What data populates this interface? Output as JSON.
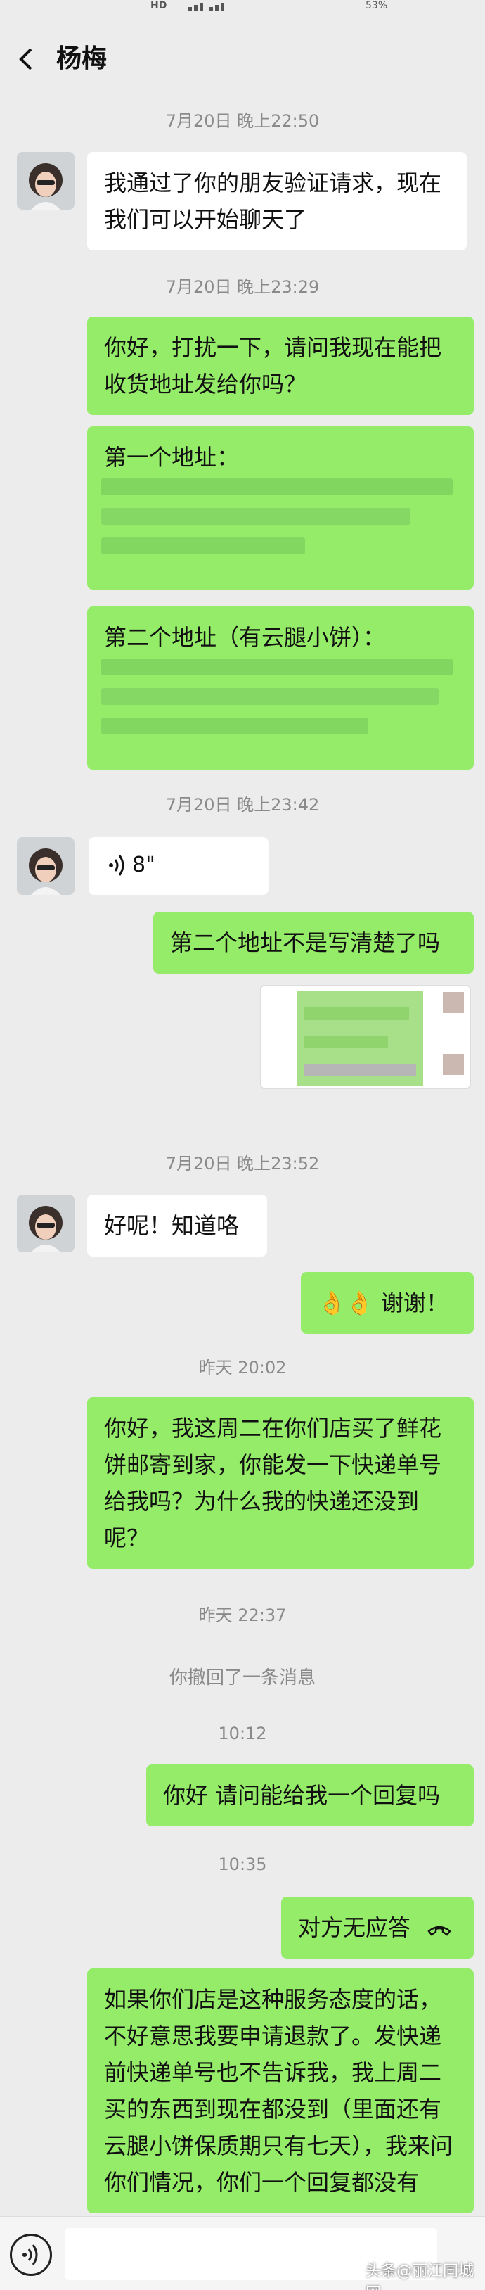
{
  "status": {
    "network": "HD",
    "battery": "53%"
  },
  "header": {
    "title": "杨梅"
  },
  "messages": {
    "ts1": "7月20日 晚上22:50",
    "m1": "我通过了你的朋友验证请求，现在我们可以开始聊天了",
    "ts2": "7月20日 晚上23:29",
    "m2": "你好，打扰一下，请问我现在能把收货地址发给你吗？",
    "m3": "第一个地址：",
    "m4": "第二个地址（有云腿小饼）：",
    "ts3": "7月20日 晚上23:42",
    "voice_duration": "8\"",
    "m5": "第二个地址不是写清楚了吗",
    "ts4": "7月20日 晚上23:52",
    "m6": "好呢！知道咯",
    "m7_emoji": "👌👌",
    "m7": "谢谢！",
    "ts5": "昨天 20:02",
    "m8": "你好，我这周二在你们店买了鲜花饼邮寄到家，你能发一下快递单号给我吗？为什么我的快递还没到呢？",
    "ts6": "昨天 22:37",
    "sys1": "你撤回了一条消息",
    "ts7": "10:12",
    "m9": "你好 请问能给我一个回复吗",
    "ts8": "10:35",
    "m10": "对方无应答",
    "m11": "如果你们店是这种服务态度的话，不好意思我要申请退款了。发快递前快递单号也不告诉我，我上周二买的东西到现在都没到（里面还有云腿小饼保质期只有七天），我来问你们情况，你们一个回复都没有"
  },
  "footer": {
    "watermark": "头条@丽江同城网"
  },
  "colors": {
    "background": "#ececec",
    "outgoing": "#95ec69",
    "incoming": "#ffffff"
  }
}
